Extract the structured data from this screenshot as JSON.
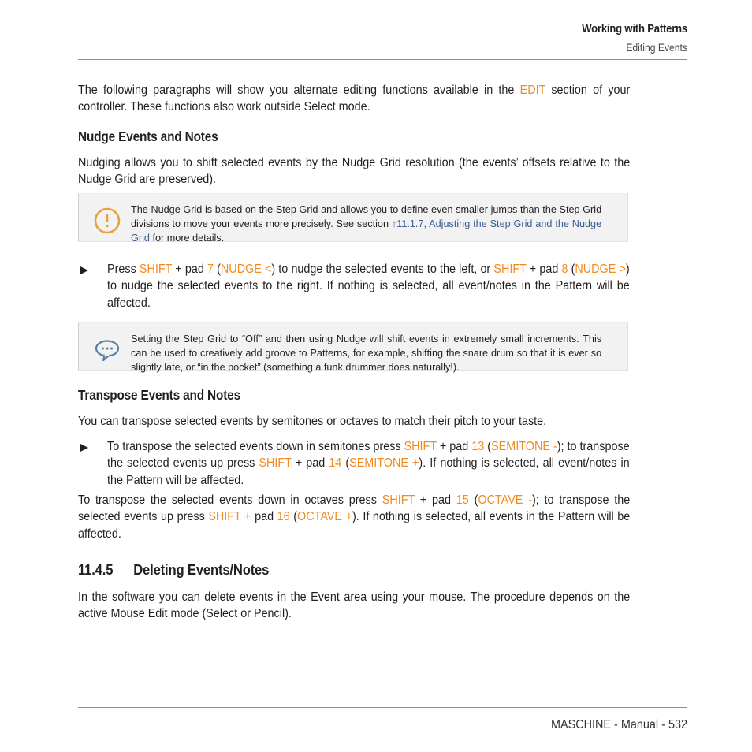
{
  "header": {
    "title": "Working with Patterns",
    "subtitle": "Editing Events"
  },
  "intro": {
    "text_before": "The following paragraphs will show you alternate editing functions available in the ",
    "highlight": "EDIT",
    "text_after": " section of your controller. These functions also work outside Select mode."
  },
  "sections": {
    "nudge_heading": "Nudge Events and Notes",
    "nudge_paragraph": "Nudging allows you to shift selected events by the Nudge Grid resolution (the events’ offsets relative to the Nudge Grid are preserved).",
    "transpose_heading": "Transpose Events and Notes",
    "transpose_paragraph": "You can transpose selected events by semitones or octaves to match their pitch to your taste.",
    "deleting_number": "11.4.5",
    "deleting_heading": "Deleting Events/Notes",
    "deleting_paragraph": "In the software you can delete events in the Event area using your mouse. The procedure depends on the active Mouse Edit mode (Select or Pencil)."
  },
  "note_callout": {
    "icon": "exclamation-circle-icon",
    "part1": "The Nudge Grid is based on the Step Grid and allows you to define even smaller jumps than the Step Grid divisions to move your events more precisely. See section ",
    "link": "↑11.1.7, Adjusting the Step Grid and the Nudge Grid",
    "part2": " for more details."
  },
  "tip_callout": {
    "icon": "speech-bubble-icon",
    "text": "Setting the Step Grid to “Off” and then using Nudge will shift events in extremely small increments. This can be used to creatively add groove to Patterns, for example, shifting the snare drum so that it is ever so slightly late, or “in the pocket” (something a funk drummer does naturally!)."
  },
  "nudge_bullet": {
    "marker": "triangle-bullet-icon",
    "t1": "Press ",
    "k1": "SHIFT",
    "t2": " + pad ",
    "k2": "7",
    "t3": " (",
    "k3": "NUDGE <",
    "t4": ") to nudge the selected events to the left, or ",
    "k4": "SHIFT",
    "t5": " + pad ",
    "k5": "8",
    "t6": " (",
    "k6": "NUDGE >",
    "t7": ") to nudge the selected events to the right. If nothing is selected, all event/notes in the Pattern will be affected."
  },
  "transpose_bullet": {
    "marker": "triangle-bullet-icon",
    "t1": "To transpose the selected events down in semitones press ",
    "k1": "SHIFT",
    "t2": " + pad ",
    "k2": "13",
    "t3": " (",
    "k3": "SEMITONE -",
    "t4": "); to transpose the selected events up press ",
    "k4": "SHIFT",
    "t5": " + pad ",
    "k5": "14",
    "t6": " (",
    "k6": "SEMITONE +",
    "t7": "). If nothing is selected, all event/notes in the Pattern will be affected."
  },
  "octave_paragraph": {
    "t1": "To transpose the selected events down in octaves press ",
    "k1": "SHIFT",
    "t2": " + pad ",
    "k2": "15",
    "t3": " (",
    "k3": "OCTAVE -",
    "t4": "); to transpose the selected events up press ",
    "k4": "SHIFT",
    "t5": " + pad ",
    "k5": "16",
    "t6": " (",
    "k6": "OCTAVE +",
    "t7": "). If nothing is selected, all events in the Pattern will be affected."
  },
  "footer": {
    "text": "MASCHINE - Manual - 532"
  },
  "colors": {
    "accent_orange": "#f18a21",
    "link_blue": "#3a5c94",
    "text": "#231f20",
    "callout_bg": "#f2f2f2",
    "tip_icon": "#5b7fa6",
    "rule": "#8e8e8e"
  }
}
